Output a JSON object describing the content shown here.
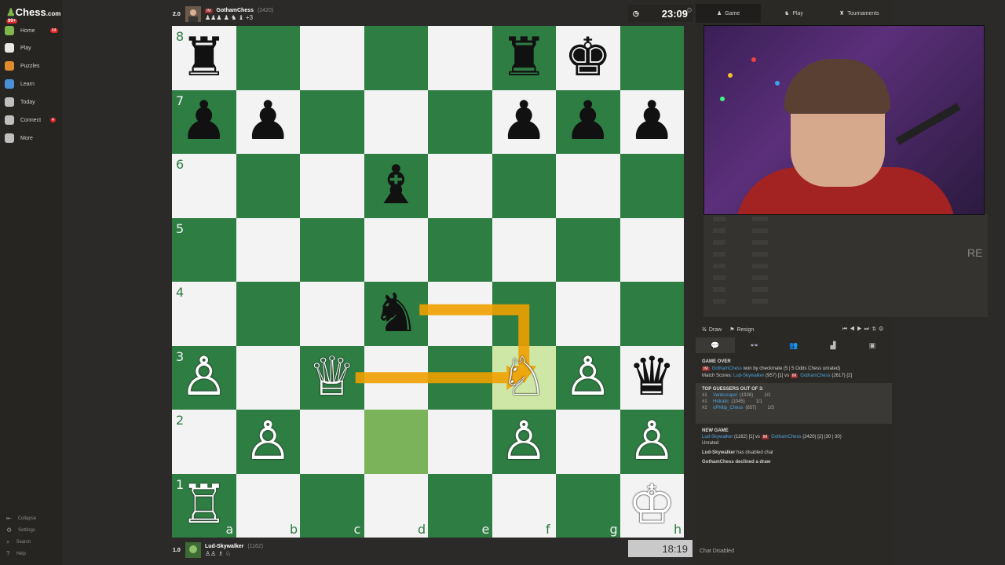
{
  "app": {
    "logo": "Chess",
    "logo_suffix": ".com",
    "logo_badge": "99+"
  },
  "sidebar": {
    "items": [
      {
        "label": "Home",
        "count": "64",
        "color": "#81b64c"
      },
      {
        "label": "Play",
        "count": "",
        "color": "#e8e8e8"
      },
      {
        "label": "Puzzles",
        "count": "",
        "color": "#e08b2d"
      },
      {
        "label": "Learn",
        "count": "",
        "color": "#4a90d9"
      },
      {
        "label": "Today",
        "count": "",
        "color": "#bfbfbf"
      },
      {
        "label": "Connect",
        "count": "4",
        "color": "#bfbfbf"
      },
      {
        "label": "More",
        "count": "",
        "color": "#bfbfbf"
      }
    ],
    "footer": [
      "Collapse",
      "Settings",
      "Search",
      "Help"
    ]
  },
  "top_player": {
    "score": "2.0",
    "title": "IM",
    "name": "GothamChess",
    "rating": "(2420)",
    "captured": "♟♟♟ ♟ ♞ ♝ +3",
    "clock": "23:09"
  },
  "bottom_player": {
    "score": "1.0",
    "name": "Lud-Skywalker",
    "rating": "(1162)",
    "captured": "♙♙ ♗ ♘",
    "clock": "18:19"
  },
  "board": {
    "ranks": [
      "8",
      "7",
      "6",
      "5",
      "4",
      "3",
      "2",
      "1"
    ],
    "files": [
      "a",
      "b",
      "c",
      "d",
      "e",
      "f",
      "g",
      "h"
    ],
    "highlight_squares": [
      "d2",
      "f3"
    ],
    "colors": {
      "light": "#f3f3f3",
      "dark": "#2e7d43",
      "arrow": "#f0a000"
    },
    "pieces": [
      {
        "sq": "a8",
        "p": "♜",
        "c": "black"
      },
      {
        "sq": "f8",
        "p": "♜",
        "c": "black"
      },
      {
        "sq": "g8",
        "p": "♚",
        "c": "black"
      },
      {
        "sq": "a7",
        "p": "♟",
        "c": "black"
      },
      {
        "sq": "b7",
        "p": "♟",
        "c": "black"
      },
      {
        "sq": "f7",
        "p": "♟",
        "c": "black"
      },
      {
        "sq": "g7",
        "p": "♟",
        "c": "black"
      },
      {
        "sq": "h7",
        "p": "♟",
        "c": "black"
      },
      {
        "sq": "d6",
        "p": "♝",
        "c": "black"
      },
      {
        "sq": "d4",
        "p": "♞",
        "c": "black"
      },
      {
        "sq": "h3",
        "p": "♛",
        "c": "black"
      },
      {
        "sq": "a3",
        "p": "♙",
        "c": "white"
      },
      {
        "sq": "c3",
        "p": "♕",
        "c": "white"
      },
      {
        "sq": "f3",
        "p": "♘",
        "c": "white"
      },
      {
        "sq": "g3",
        "p": "♙",
        "c": "white"
      },
      {
        "sq": "b2",
        "p": "♙",
        "c": "white"
      },
      {
        "sq": "f2",
        "p": "♙",
        "c": "white"
      },
      {
        "sq": "h2",
        "p": "♙",
        "c": "white"
      },
      {
        "sq": "a1",
        "p": "♖",
        "c": "white"
      },
      {
        "sq": "h1",
        "p": "♔",
        "c": "white"
      }
    ],
    "arrows": [
      {
        "from": "d4",
        "to": "f3",
        "kind": "knight"
      },
      {
        "from": "c3",
        "to": "f3",
        "kind": "straight"
      }
    ]
  },
  "panel": {
    "tabs": [
      "Game",
      "Play",
      "Tournaments"
    ],
    "stream_text": "RE",
    "controls": {
      "draw": "Draw",
      "resign": "Resign"
    },
    "game_over_title": "GAME OVER",
    "game_over_line1_name": "GothamChess",
    "game_over_line1_rest": " won by checkmate (5 | 5 Odds Chess unrated)",
    "match_score_label": "Match Scores: ",
    "match_score_p1": "Lud-Skywalker",
    "match_score_mid": " (957) [1] vs ",
    "match_score_p2": "GothamChess",
    "match_score_end": " (2617) [2]",
    "guessers_title": "TOP GUESSERS OUT OF 3:",
    "guessers": [
      {
        "rank": "#1",
        "name": "Vankusupel",
        "rating": "(1926)",
        "score": "1/1"
      },
      {
        "rank": "#1",
        "name": "Hidratic",
        "rating": "(1045)",
        "score": "1/1"
      },
      {
        "rank": "#2",
        "name": "oPhilip_Chess",
        "rating": "(857)",
        "score": "1/3"
      }
    ],
    "new_game_title": "NEW GAME",
    "new_game_p1": "Lud-Skywalker",
    "new_game_mid": " (1162) [1] vs ",
    "new_game_p2": "GothamChess",
    "new_game_end": " (2420) [2] (30 | 30)",
    "new_game_unrated": "Unrated",
    "msg1_name": "Lud-Skywalker",
    "msg1_rest": " has disabled chat",
    "msg2": "GothamChess declined a draw",
    "chat_disabled": "Chat Disabled"
  }
}
